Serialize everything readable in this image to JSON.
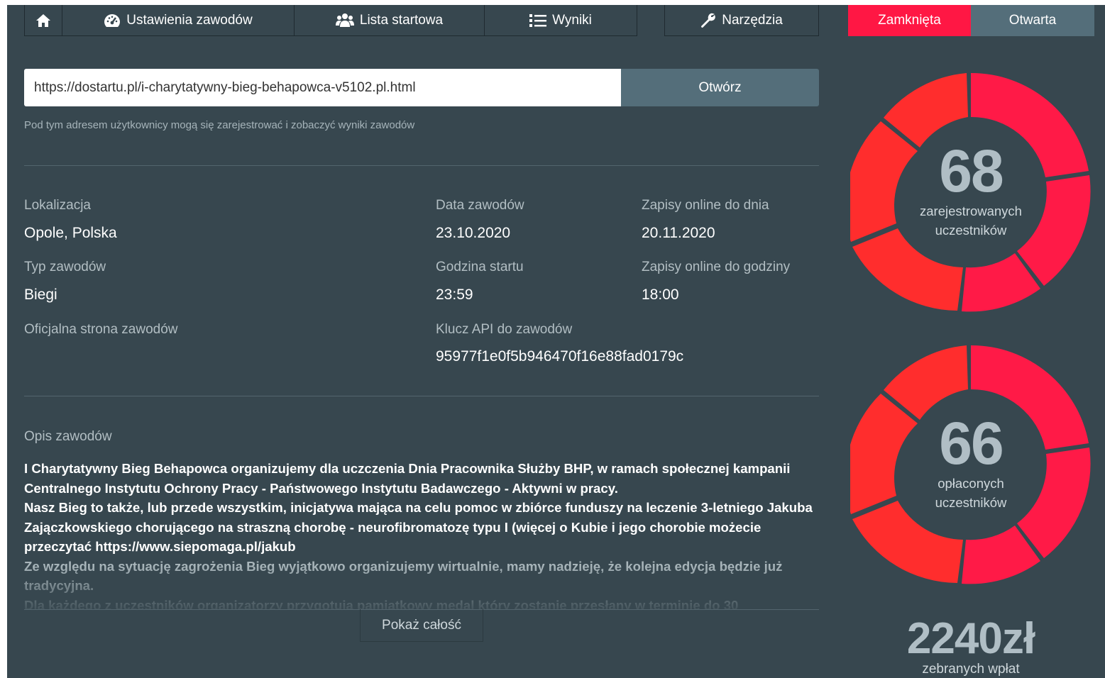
{
  "nav": {
    "settings_label": "Ustawienia zawodów",
    "start_list_label": "Lista startowa",
    "results_label": "Wyniki",
    "tools_label": "Narzędzia"
  },
  "status": {
    "closed_label": "Zamknięta",
    "open_label": "Otwarta",
    "closed_color": "#ff1744",
    "open_color": "#546e7a"
  },
  "url": {
    "value": "https://dostartu.pl/i-charytatywny-bieg-behapowca-v5102.pl.html",
    "open_label": "Otwórz",
    "hint": "Pod tym adresem użytkownicy mogą się zarejestrować i zobaczyć wyniki zawodów"
  },
  "details": {
    "location_label": "Lokalizacja",
    "location_value": "Opole, Polska",
    "date_label": "Data zawodów",
    "date_value": "23.10.2020",
    "reg_until_label": "Zapisy online do dnia",
    "reg_until_value": "20.11.2020",
    "type_label": "Typ zawodów",
    "type_value": "Biegi",
    "start_time_label": "Godzina startu",
    "start_time_value": "23:59",
    "reg_hour_label": "Zapisy online do godziny",
    "reg_hour_value": "18:00",
    "website_label": "Oficjalna strona zawodów",
    "api_label": "Klucz API do zawodów",
    "api_value": "95977f1e0f5b946470f16e88fad0179c"
  },
  "description": {
    "label": "Opis zawodów",
    "p1": "I Charytatywny Bieg Behapowca organizujemy dla uczczenia Dnia Pracownika Służby BHP, w ramach społecznej kampanii Centralnego Instytutu Ochrony Pracy - Państwowego Instytutu Badawczego - Aktywni w pracy.",
    "p2": "Nasz Bieg to także, lub przede wszystkim, inicjatywa mająca na celu pomoc w zbiórce funduszy na leczenie 3-letniego Jakuba Zajączkowskiego chorującego na straszną chorobę - neurofibromatozę typu I (więcej o Kubie i jego chorobie możecie przeczytać https://www.siepomaga.pl/jakub",
    "p3": "Ze względu na sytuację zagrożenia Bieg wyjątkowo organizujemy wirtualnie, mamy nadzieję, że kolejna edycja będzie już tradycyjna.",
    "p4": "Dla każdego z uczestników organizatorzy przygotują pamiątkowy medal który zostanie przesłany w terminie do 30",
    "show_all_label": "Pokaż całość"
  },
  "stats": {
    "registered": {
      "value": "68",
      "line1": "zarejestrowanych",
      "line2": "uczestników"
    },
    "paid": {
      "value": "66",
      "line1": "opłaconych",
      "line2": "uczestników"
    },
    "collected": {
      "value": "2240zł",
      "label": "zebranych wpłat"
    },
    "donut_colors": [
      "#ff1a47",
      "#ff2d2d"
    ]
  }
}
